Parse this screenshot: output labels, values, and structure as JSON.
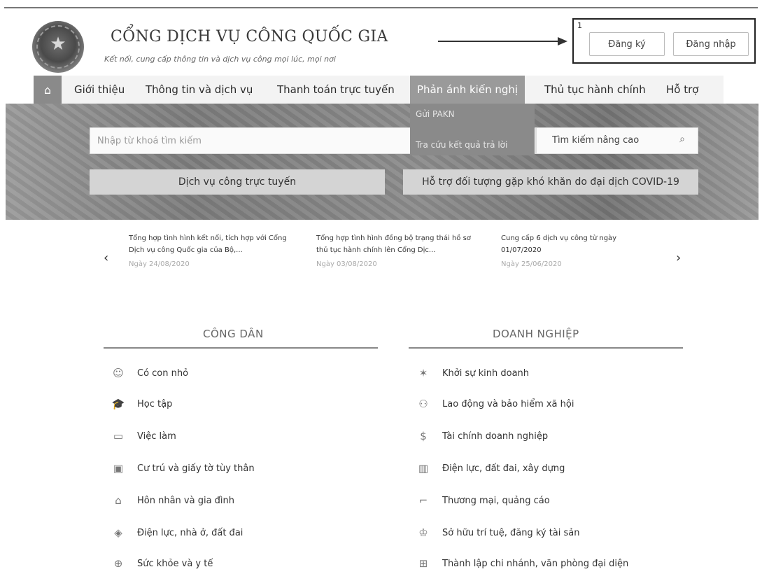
{
  "header": {
    "title": "CỔNG DỊCH VỤ CÔNG QUỐC GIA",
    "subtitle": "Kết nối, cung cấp thông tin và dịch vụ công mọi lúc, mọi nơi",
    "annotation_number": "1",
    "register_label": "Đăng ký",
    "login_label": "Đăng nhập"
  },
  "nav": {
    "items": [
      "Giới thiệu",
      "Thông tin và dịch vụ",
      "Thanh toán trực tuyến",
      "Phản ánh kiến nghị",
      "Thủ tục hành chính",
      "Hỗ trợ"
    ],
    "dropdown": [
      "Gửi PAKN",
      "Tra cứu kết quả trả lời"
    ]
  },
  "search": {
    "placeholder": "Nhập từ khoá tìm kiếm",
    "advanced_label": "Tìm kiếm nâng cao"
  },
  "services": {
    "online": "Dịch vụ công trực tuyến",
    "covid": "Hỗ trợ đối tượng gặp khó khăn do đại dịch COVID-19"
  },
  "news": [
    {
      "title": "Tổng hợp tình hình kết nối, tích hợp với Cổng Dịch vụ công Quốc gia của Bộ,...",
      "date": "Ngày 24/08/2020"
    },
    {
      "title": "Tổng hợp tình hình đồng bộ trạng thái hồ sơ thủ tục hành chính lên Cổng Dịc...",
      "date": "Ngày 03/08/2020"
    },
    {
      "title": "Cung cấp 6 dịch vụ công từ ngày 01/07/2020",
      "date": "Ngày 25/06/2020"
    }
  ],
  "citizen": {
    "title": "CÔNG DÂN",
    "items": [
      "Có con nhỏ",
      "Học tập",
      "Việc làm",
      "Cư trú và giấy tờ tùy thân",
      "Hôn nhân và gia đình",
      "Điện lực, nhà ở, đất đai",
      "Sức khỏe và y tế"
    ]
  },
  "business": {
    "title": "DOANH NGHIỆP",
    "items": [
      "Khởi sự kinh doanh",
      "Lao động và bảo hiểm xã hội",
      "Tài chính doanh nghiệp",
      "Điện lực, đất đai, xây dựng",
      "Thương mại, quảng cáo",
      "Sở hữu trí tuệ, đăng ký tài sản",
      "Thành lập chi nhánh, văn phòng đại diện"
    ]
  }
}
